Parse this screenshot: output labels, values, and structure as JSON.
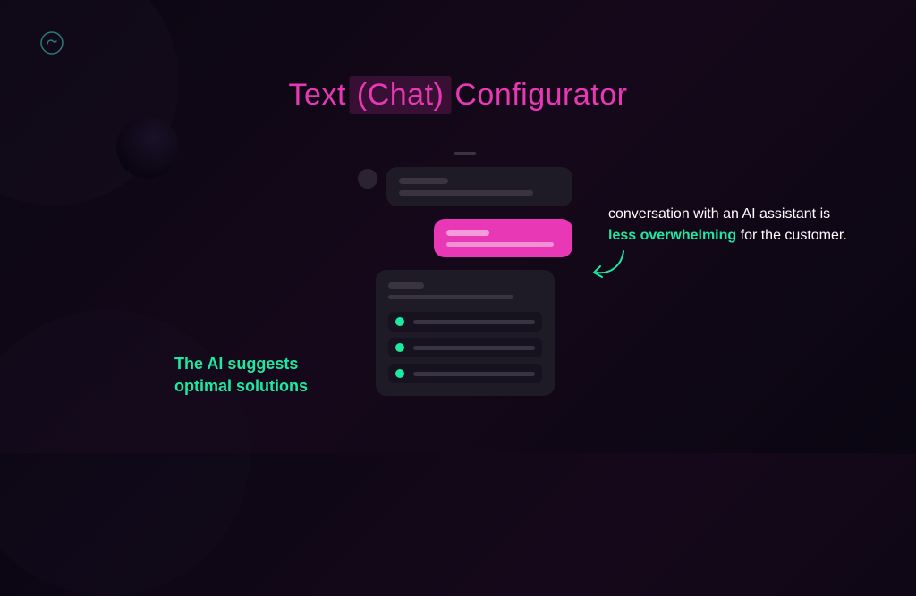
{
  "title": {
    "prefix": "Text",
    "highlight": "(Chat)",
    "suffix": "Configurator"
  },
  "caption_right": {
    "line1": "conversation with an AI assistant is",
    "highlight": "less overwhelming",
    "line2_tail": " for the customer."
  },
  "caption_left": "The AI suggests optimal solutions",
  "colors": {
    "accent_pink": "#e838b5",
    "accent_green": "#1de9a0"
  }
}
